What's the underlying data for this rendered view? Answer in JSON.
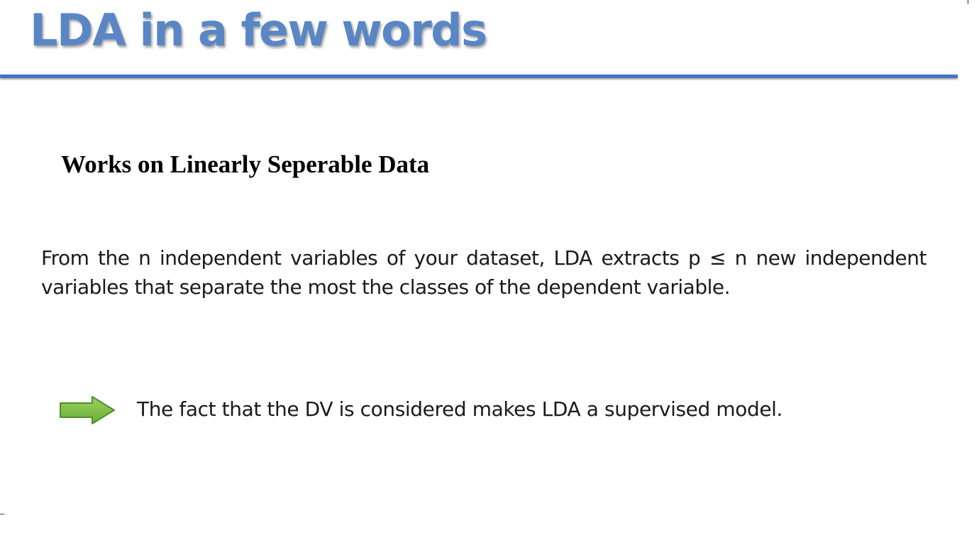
{
  "slide": {
    "title": "LDA in a few words",
    "subheading": "Works on Linearly Seperable Data",
    "paragraph": "From the n independent variables of your dataset, LDA extracts p ≤ n new independent variables that separate the most the classes of the dependent variable.",
    "conclusion": {
      "icon": "right-arrow-icon",
      "text": "The fact that the DV is considered makes LDA a supervised model."
    }
  },
  "colors": {
    "title": "#5a86c5",
    "rule": "#4472c4",
    "arrow_fill": "#7ac143",
    "arrow_stroke": "#4e8f2a"
  }
}
